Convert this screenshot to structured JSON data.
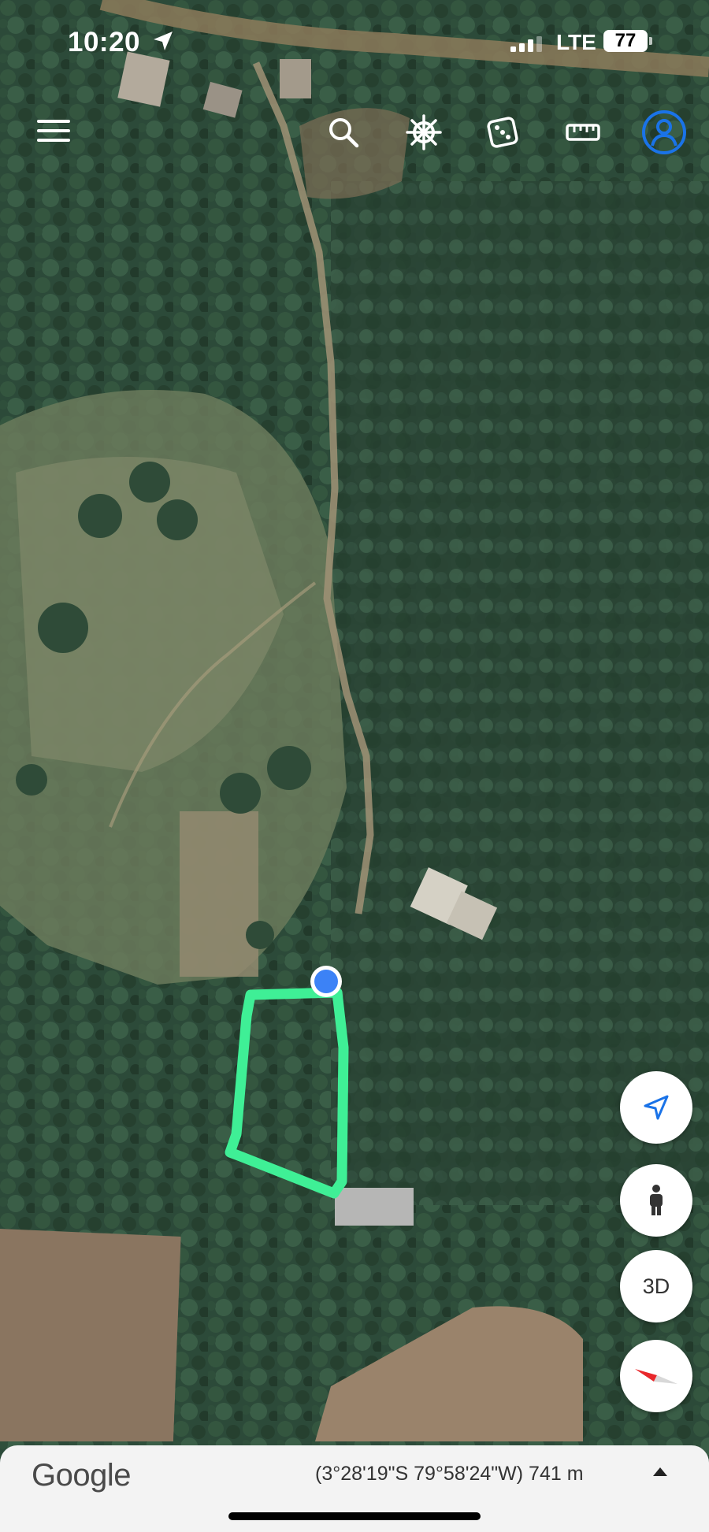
{
  "status_bar": {
    "time": "10:20",
    "carrier": "LTE",
    "battery": "77"
  },
  "toolbar": {
    "icons": [
      "menu-icon",
      "search-icon",
      "ship-wheel-icon",
      "dice-icon",
      "ruler-icon",
      "profile-icon"
    ]
  },
  "map": {
    "boundary_color": "#3fef96",
    "marker_color": "#3c82f6"
  },
  "controls": {
    "three_d_label": "3D"
  },
  "footer": {
    "logo": "Google",
    "coordinates": "(3°28'19\"S 79°58'24\"W) 741 m"
  }
}
